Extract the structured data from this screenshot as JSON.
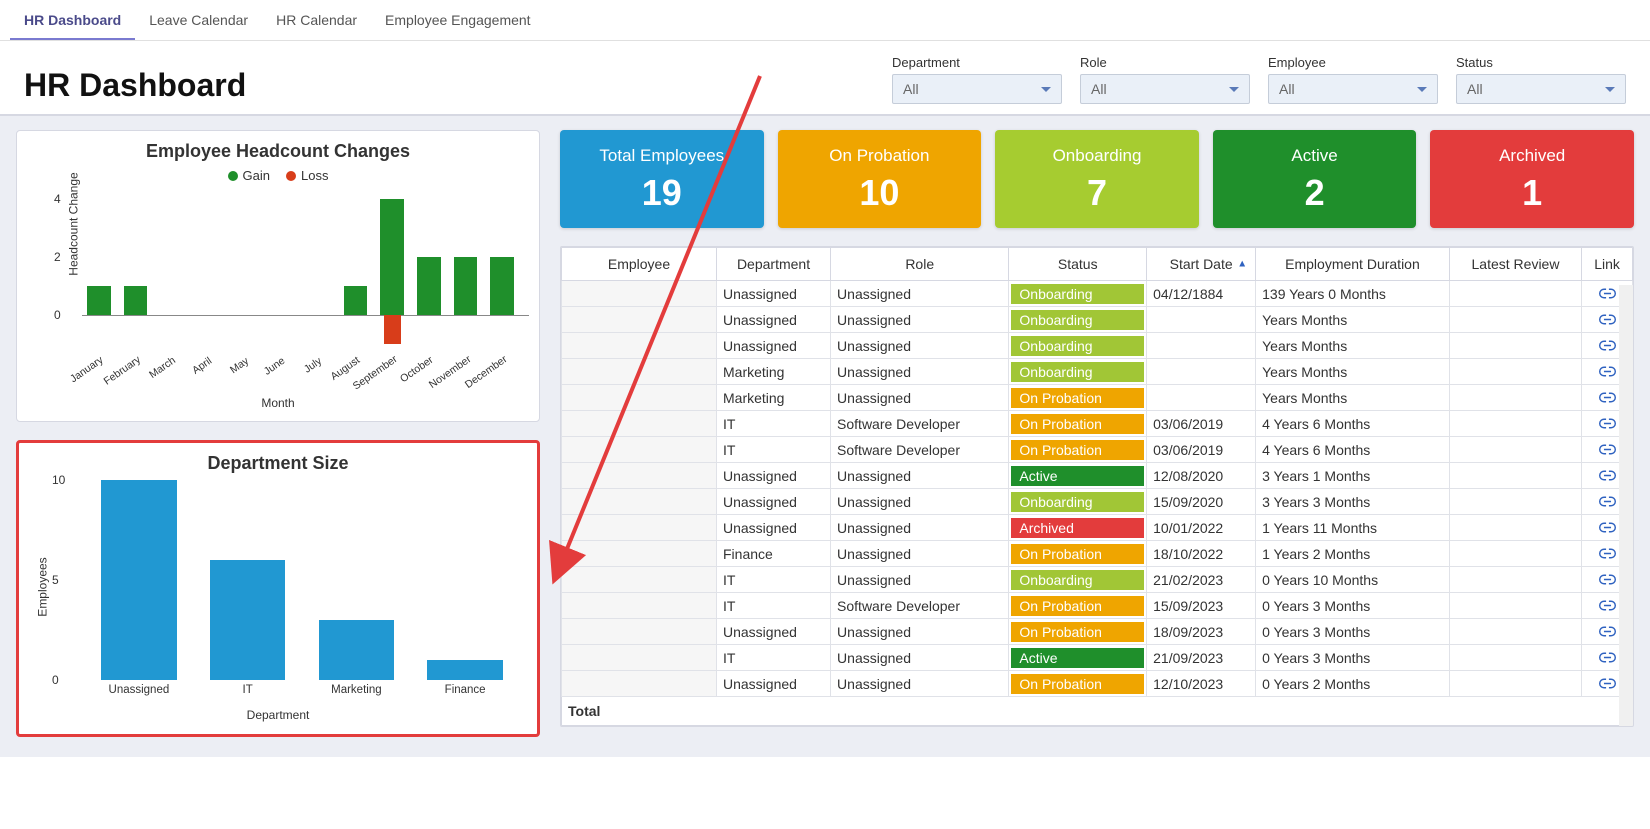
{
  "tabs": [
    {
      "label": "HR Dashboard",
      "active": true
    },
    {
      "label": "Leave Calendar",
      "active": false
    },
    {
      "label": "HR Calendar",
      "active": false
    },
    {
      "label": "Employee Engagement",
      "active": false
    }
  ],
  "page_title": "HR Dashboard",
  "filters": [
    {
      "label": "Department",
      "value": "All"
    },
    {
      "label": "Role",
      "value": "All"
    },
    {
      "label": "Employee",
      "value": "All"
    },
    {
      "label": "Status",
      "value": "All"
    }
  ],
  "cards": [
    {
      "label": "Total Employees",
      "value": "19",
      "cls": "c-blue"
    },
    {
      "label": "On Probation",
      "value": "10",
      "cls": "c-orange"
    },
    {
      "label": "Onboarding",
      "value": "7",
      "cls": "c-lime"
    },
    {
      "label": "Active",
      "value": "2",
      "cls": "c-green"
    },
    {
      "label": "Archived",
      "value": "1",
      "cls": "c-red"
    }
  ],
  "headcount": {
    "title": "Employee Headcount Changes",
    "legend": {
      "gain": "Gain",
      "loss": "Loss"
    },
    "xlabel": "Month",
    "ylabel": "Headcount Change",
    "yticks": [
      "0",
      "2",
      "4"
    ]
  },
  "dept": {
    "title": "Department Size",
    "xlabel": "Department",
    "ylabel": "Employees",
    "yticks": [
      "0",
      "5",
      "10"
    ]
  },
  "table": {
    "headers": [
      "Employee",
      "Department",
      "Role",
      "Status",
      "Start Date",
      "Employment Duration",
      "Latest Review",
      "Link"
    ],
    "sort_col": 4,
    "footer": "Total",
    "rows": [
      {
        "dept": "Unassigned",
        "role": "Unassigned",
        "status": "Onboarding",
        "start": "04/12/1884",
        "dur": "139 Years 0 Months"
      },
      {
        "dept": "Unassigned",
        "role": "Unassigned",
        "status": "Onboarding",
        "start": "",
        "dur": "Years Months"
      },
      {
        "dept": "Unassigned",
        "role": "Unassigned",
        "status": "Onboarding",
        "start": "",
        "dur": "Years Months"
      },
      {
        "dept": "Marketing",
        "role": "Unassigned",
        "status": "Onboarding",
        "start": "",
        "dur": "Years Months"
      },
      {
        "dept": "Marketing",
        "role": "Unassigned",
        "status": "On Probation",
        "start": "",
        "dur": "Years Months"
      },
      {
        "dept": "IT",
        "role": "Software Developer",
        "status": "On Probation",
        "start": "03/06/2019",
        "dur": "4 Years 6 Months"
      },
      {
        "dept": "IT",
        "role": "Software Developer",
        "status": "On Probation",
        "start": "03/06/2019",
        "dur": "4 Years 6 Months"
      },
      {
        "dept": "Unassigned",
        "role": "Unassigned",
        "status": "Active",
        "start": "12/08/2020",
        "dur": "3 Years 1 Months"
      },
      {
        "dept": "Unassigned",
        "role": "Unassigned",
        "status": "Onboarding",
        "start": "15/09/2020",
        "dur": "3 Years 3 Months"
      },
      {
        "dept": "Unassigned",
        "role": "Unassigned",
        "status": "Archived",
        "start": "10/01/2022",
        "dur": "1 Years 11 Months"
      },
      {
        "dept": "Finance",
        "role": "Unassigned",
        "status": "On Probation",
        "start": "18/10/2022",
        "dur": "1 Years 2 Months"
      },
      {
        "dept": "IT",
        "role": "Unassigned",
        "status": "Onboarding",
        "start": "21/02/2023",
        "dur": "0 Years 10 Months"
      },
      {
        "dept": "IT",
        "role": "Software Developer",
        "status": "On Probation",
        "start": "15/09/2023",
        "dur": "0 Years 3 Months"
      },
      {
        "dept": "Unassigned",
        "role": "Unassigned",
        "status": "On Probation",
        "start": "18/09/2023",
        "dur": "0 Years 3 Months"
      },
      {
        "dept": "IT",
        "role": "Unassigned",
        "status": "Active",
        "start": "21/09/2023",
        "dur": "0 Years 3 Months"
      },
      {
        "dept": "Unassigned",
        "role": "Unassigned",
        "status": "On Probation",
        "start": "12/10/2023",
        "dur": "0 Years 2 Months"
      }
    ]
  },
  "chart_data": [
    {
      "type": "bar",
      "title": "Employee Headcount Changes",
      "xlabel": "Month",
      "ylabel": "Headcount Change",
      "ylim": [
        -1,
        4
      ],
      "categories": [
        "January",
        "February",
        "March",
        "April",
        "May",
        "June",
        "July",
        "August",
        "September",
        "October",
        "November",
        "December"
      ],
      "series": [
        {
          "name": "Gain",
          "values": [
            1,
            1,
            0,
            0,
            0,
            0,
            0,
            1,
            4,
            2,
            2,
            2
          ]
        },
        {
          "name": "Loss",
          "values": [
            0,
            0,
            0,
            0,
            0,
            0,
            0,
            0,
            -1,
            0,
            0,
            0
          ]
        }
      ]
    },
    {
      "type": "bar",
      "title": "Department Size",
      "xlabel": "Department",
      "ylabel": "Employees",
      "ylim": [
        0,
        10
      ],
      "categories": [
        "Unassigned",
        "IT",
        "Marketing",
        "Finance"
      ],
      "values": [
        10,
        6,
        3,
        1
      ]
    }
  ]
}
